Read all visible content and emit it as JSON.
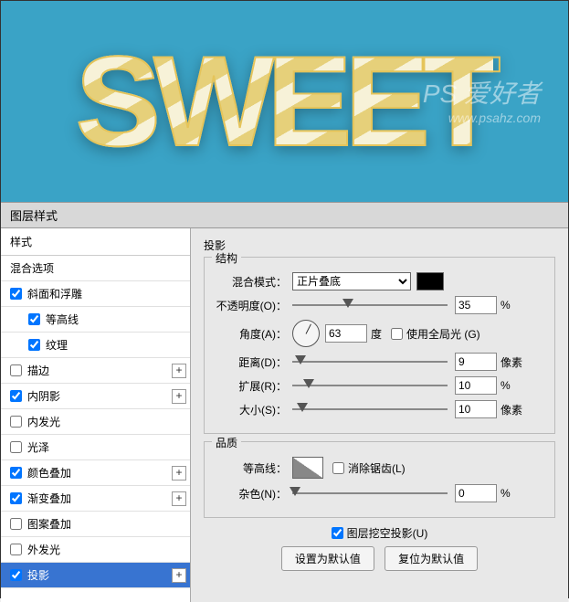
{
  "preview": {
    "text": "SWEET",
    "watermark_line1": "PS 爱好者",
    "watermark_line2": "www.psahz.com"
  },
  "dialog": {
    "title": "图层样式"
  },
  "sidebar": {
    "styles_header": "样式",
    "blend_header": "混合选项",
    "items": [
      {
        "label": "斜面和浮雕",
        "checked": true,
        "fx": false
      },
      {
        "label": "等高线",
        "checked": true,
        "indent": true,
        "fx": false
      },
      {
        "label": "纹理",
        "checked": true,
        "indent": true,
        "fx": false
      },
      {
        "label": "描边",
        "checked": false,
        "fx": true
      },
      {
        "label": "内阴影",
        "checked": true,
        "fx": true
      },
      {
        "label": "内发光",
        "checked": false,
        "fx": false
      },
      {
        "label": "光泽",
        "checked": false,
        "fx": false
      },
      {
        "label": "颜色叠加",
        "checked": true,
        "fx": true
      },
      {
        "label": "渐变叠加",
        "checked": true,
        "fx": true
      },
      {
        "label": "图案叠加",
        "checked": false,
        "fx": false
      },
      {
        "label": "外发光",
        "checked": false,
        "fx": false
      },
      {
        "label": "投影",
        "checked": true,
        "fx": true,
        "selected": true
      }
    ]
  },
  "panel": {
    "title": "投影",
    "structure": {
      "legend": "结构",
      "blend_mode_label": "混合模式：",
      "blend_mode_value": "正片叠底",
      "color": "#000000",
      "opacity_label": "不透明度(O)：",
      "opacity_value": "35",
      "opacity_unit": "%",
      "angle_label": "角度(A)：",
      "angle_value": "63",
      "angle_unit": "度",
      "global_light_label": "使用全局光 (G)",
      "global_light_checked": false,
      "distance_label": "距离(D)：",
      "distance_value": "9",
      "distance_unit": "像素",
      "spread_label": "扩展(R)：",
      "spread_value": "10",
      "spread_unit": "%",
      "size_label": "大小(S)：",
      "size_value": "10",
      "size_unit": "像素"
    },
    "quality": {
      "legend": "品质",
      "contour_label": "等高线：",
      "antialias_label": "消除锯齿(L)",
      "antialias_checked": false,
      "noise_label": "杂色(N)：",
      "noise_value": "0",
      "noise_unit": "%"
    },
    "knockout_label": "图层挖空投影(U)",
    "knockout_checked": true,
    "btn_default": "设置为默认值",
    "btn_reset": "复位为默认值"
  }
}
